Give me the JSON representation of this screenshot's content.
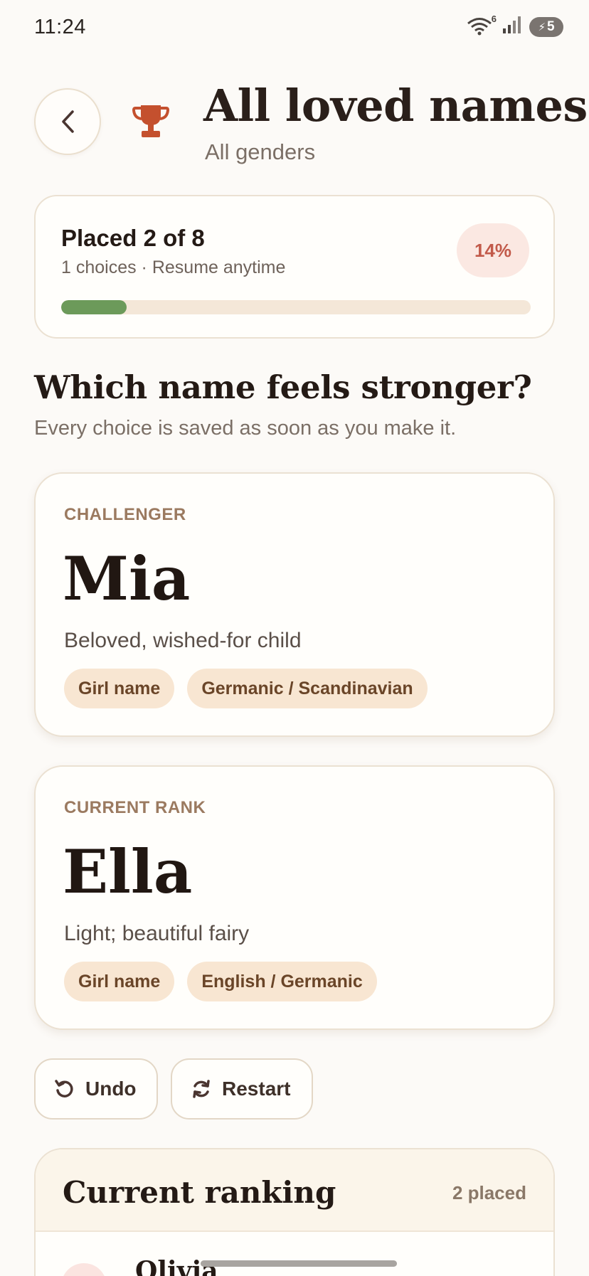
{
  "status_bar": {
    "time": "11:24",
    "wifi_badge": "6",
    "battery": "5"
  },
  "header": {
    "title": "All loved names",
    "subtitle": "All genders"
  },
  "progress": {
    "title": "Placed 2 of 8",
    "subtitle": "1 choices · Resume anytime",
    "percent_label": "14%",
    "percent": 14
  },
  "question": {
    "title": "Which name feels stronger?",
    "subtitle": "Every choice is saved as soon as you make it."
  },
  "challenger": {
    "eyebrow": "CHALLENGER",
    "name": "Mia",
    "meaning": "Beloved, wished-for child",
    "tags": [
      "Girl name",
      "Germanic / Scandinavian"
    ]
  },
  "current": {
    "eyebrow": "CURRENT RANK",
    "name": "Ella",
    "meaning": "Light; beautiful fairy",
    "tags": [
      "Girl name",
      "English / Germanic"
    ]
  },
  "actions": {
    "undo_label": "Undo",
    "restart_label": "Restart"
  },
  "ranking": {
    "title": "Current ranking",
    "count_label": "2 placed",
    "items": [
      {
        "name": "Olivia"
      }
    ]
  },
  "colors": {
    "accent_red": "#c4502e",
    "progress_green": "#6c9a5a",
    "tag_bg": "#f8e6d2"
  }
}
